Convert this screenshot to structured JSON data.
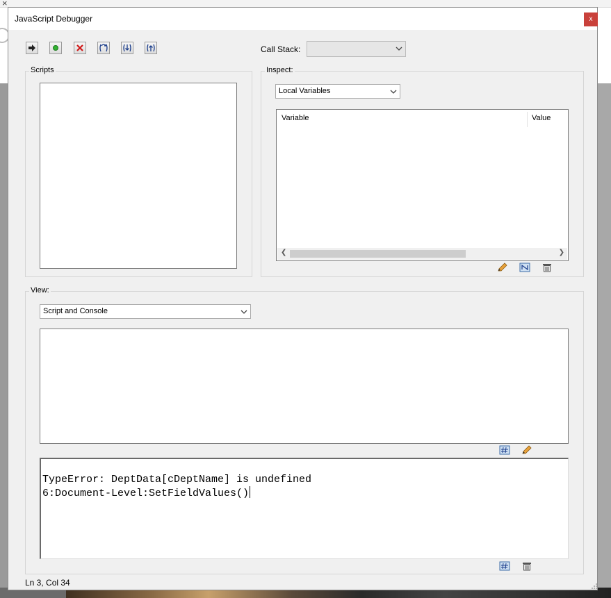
{
  "window": {
    "title": "JavaScript Debugger",
    "close_label": "x"
  },
  "toolbar": {
    "buttons": [
      {
        "name": "resume-button",
        "icon": "arrow-right-icon"
      },
      {
        "name": "break-button",
        "icon": "green-dot-icon"
      },
      {
        "name": "quit-button",
        "icon": "red-x-icon"
      },
      {
        "name": "step-over-button",
        "icon": "step-over-icon"
      },
      {
        "name": "step-into-button",
        "icon": "step-into-icon"
      },
      {
        "name": "step-out-button",
        "icon": "step-out-icon"
      }
    ],
    "call_stack_label": "Call Stack:",
    "call_stack_value": ""
  },
  "scripts": {
    "label": "Scripts"
  },
  "inspect": {
    "label": "Inspect:",
    "selected": "Local Variables",
    "columns": [
      "Variable",
      "Value"
    ]
  },
  "view": {
    "label": "View:",
    "selected": "Script and Console"
  },
  "console": {
    "lines": [
      "TypeError: DeptData[cDeptName] is undefined",
      "6:Document-Level:SetFieldValues()"
    ]
  },
  "status": {
    "position": "Ln 3, Col 34"
  },
  "colors": {
    "close": "#c9413b",
    "panel": "#f0f0f0"
  }
}
